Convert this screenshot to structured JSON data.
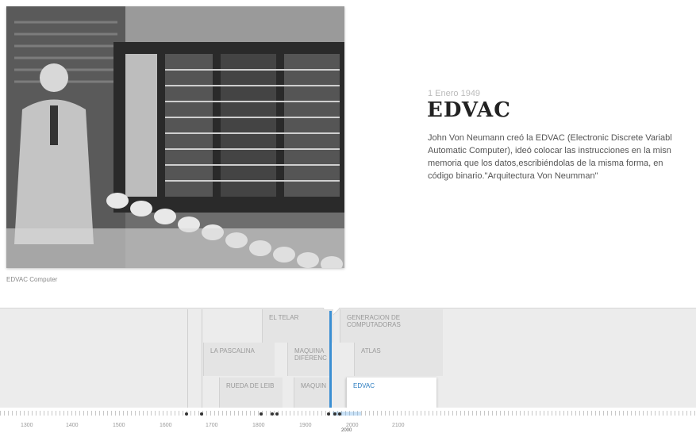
{
  "slide": {
    "date": "1 Enero 1949",
    "title": "EDVAC",
    "description": "John Von Neumann creó la EDVAC (Electronic Discrete Variabl\nAutomatic Computer), ideó colocar las instrucciones en la misn\nmemoria que los datos,escribiéndolas de la misma forma, en\ncódigo binario.\"Arquitectura Von Neumman\"",
    "caption": "EDVAC Computer"
  },
  "timeline": {
    "events": {
      "el_telar": "EL TELAR",
      "generacion": "GENERACION DE\nCOMPUTADORAS",
      "pascalina": "LA PASCALINA",
      "maquina_dif": "MAQUINA\nDIFERENC",
      "atlas": "ATLAS",
      "rueda": "RUEDA DE LEIB",
      "maquina": "MAQUIN",
      "edvac": "EDVAC"
    },
    "years": [
      "1300",
      "1400",
      "1500",
      "1600",
      "1700",
      "1800",
      "1900",
      "2000",
      "2100"
    ],
    "current_year": "2000"
  },
  "colors": {
    "accent": "#3b8fd3",
    "active_text": "#2a7bbf",
    "timeline_bg": "#ececec"
  }
}
